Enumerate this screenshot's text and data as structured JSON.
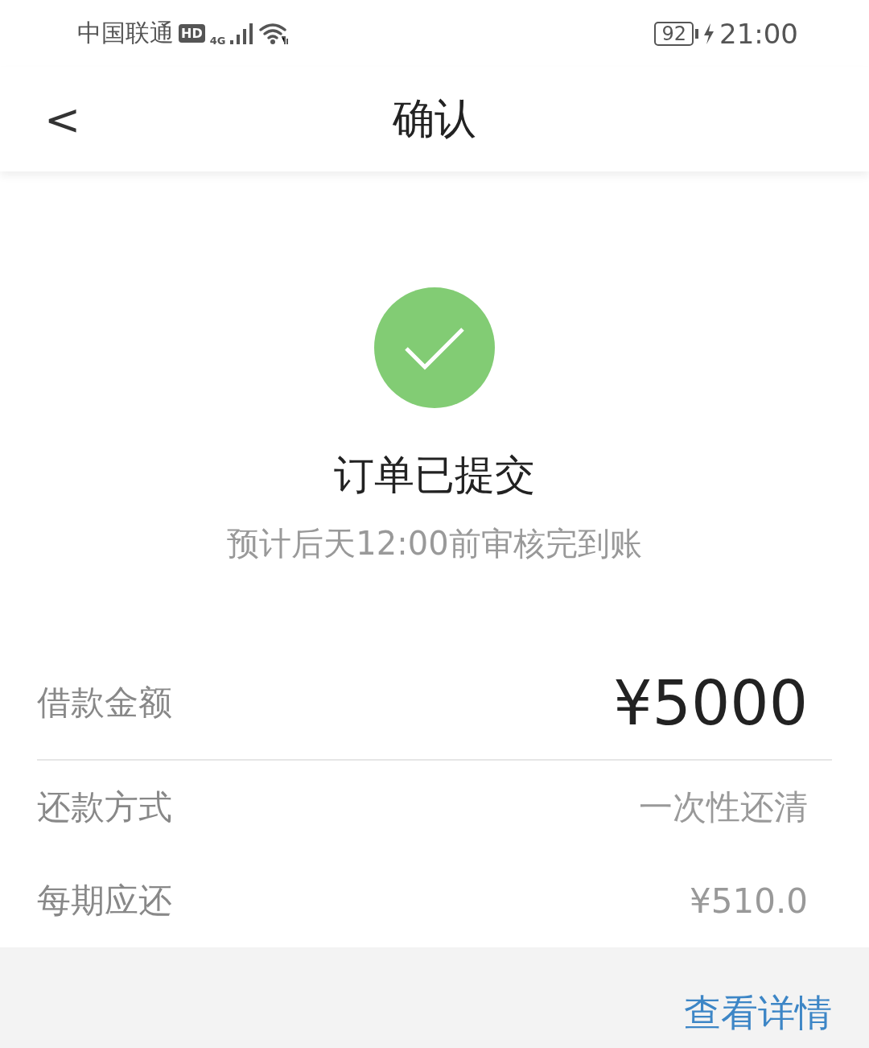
{
  "status_bar": {
    "carrier": "中国联通",
    "hd_badge": "HD",
    "network": "4G",
    "battery": "92",
    "charging": true,
    "time": "21:00"
  },
  "header": {
    "back": "<",
    "title": "确认"
  },
  "result": {
    "title": "订单已提交",
    "subtitle": "预计后天12:00前审核完到账"
  },
  "rows": [
    {
      "label": "借款金额",
      "value": "¥5000",
      "kind": "amount",
      "divider": true
    },
    {
      "label": "还款方式",
      "value": "一次性还清",
      "kind": "plain",
      "divider": false
    },
    {
      "label": "每期应还",
      "value": "¥510.0",
      "kind": "plain",
      "divider": false
    }
  ],
  "footer": {
    "link": "查看详情"
  }
}
